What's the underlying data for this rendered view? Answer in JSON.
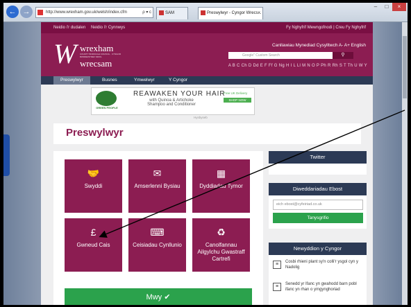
{
  "browser": {
    "address": "http://www.wrexham.gov.uk/welsh/index.cfm",
    "address_controls": "ρ ▾ c",
    "tab_small": "SAM",
    "tab_active": "Preswylwyr - Cyngor Wrecs...",
    "tab_close": "×",
    "back": "←",
    "forward": "→"
  },
  "site": {
    "top_links": [
      "Neidio i'r dudalen",
      "Neidio i'r Cynnwys"
    ],
    "top_right": "Fy Nghyfrif Mewngofnodi  |  Creu Fy Nghyfrif",
    "logo_line1": "wrexham",
    "logo_line2": "wrecsam",
    "logo_sub": "COUNTY BOROUGH COUNCIL · CYNGOR BWRDEISTREF SIROL",
    "head_links": "Canllawiau Mynediad    Cysylltwch    A-    A+    English",
    "search_placeholder": "Google\" Custom Search",
    "search_icon": "search-icon",
    "az": "A B C Ch D Dd E F Ff G Ng H I L Ll M N O P Ph R Rh S T Th U W Y",
    "nav": [
      "Preswylwyr",
      "Busnes",
      "Ymwelwyr",
      "Y Cyngor"
    ]
  },
  "ad": {
    "brand": "GREEN PEOPLE",
    "brand_sub": "Organic Lifestyle",
    "headline": "REAWAKEN YOUR HAIR",
    "with": "with Quinoa & Artichoke Shampoo and Conditioner",
    "free": "Free UK Delivery",
    "shop": "SHOP NOW",
    "label": "Hysbyseb"
  },
  "main": {
    "title": "Preswylwyr",
    "tiles": [
      {
        "label": "Swyddi",
        "icon": "handshake-icon",
        "glyph": "🤝"
      },
      {
        "label": "Amserlenni Bysiau",
        "icon": "envelope-icon",
        "glyph": "✉"
      },
      {
        "label": "Dyddiadau Tymor",
        "icon": "calendar-icon",
        "glyph": "▦"
      },
      {
        "label": "Gwneud Cais",
        "icon": "pound-icon",
        "glyph": "£"
      },
      {
        "label": "Ceisiadau Cynllunio",
        "icon": "keyboard-icon",
        "glyph": "⌨"
      },
      {
        "label": "Canolfannau Ailgylchu Gwastraff Cartrefi",
        "icon": "recycle-icon",
        "glyph": "♻"
      }
    ],
    "more_button": "Mwy ✔"
  },
  "sidebar": {
    "twitter": "Twitter",
    "email_header": "Diweddariadau Ebost",
    "email_placeholder": "eich ebost@cyfeiriad.co.uk",
    "subscribe": "Tanysgrifio",
    "news_header": "Newyddion y Cyngor",
    "news": [
      "Cosbi rhieni plant sy'n colli'r ysgol cyn y Nadolig",
      "Senedd yr Ifanc yn gwahodd barn pobl ifanc yn rhan o ymgynghoriad"
    ]
  }
}
